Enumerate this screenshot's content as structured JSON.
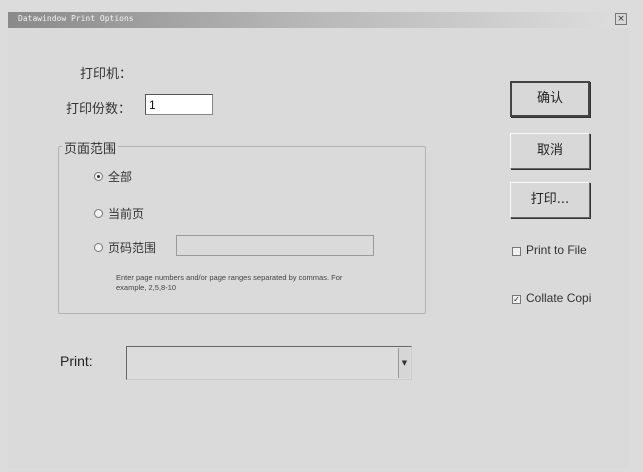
{
  "window": {
    "title": "Datawindow Print Options",
    "close_glyph": "×"
  },
  "printer": {
    "label": "打印机："
  },
  "copies": {
    "label": "打印份数：",
    "value": "1"
  },
  "page_range": {
    "group_title": "页面范围",
    "options": [
      {
        "label": "全部",
        "checked": true
      },
      {
        "label": "当前页",
        "checked": false
      },
      {
        "label": "页码范围",
        "checked": false
      }
    ],
    "range_value": "",
    "hint": "Enter page numbers and/or page ranges separated by commas. For example, 2,5,8-10"
  },
  "buttons": {
    "ok": "确认",
    "cancel": "取消",
    "print": "打印..."
  },
  "checkboxes": {
    "print_to_file": {
      "label": "Print to File",
      "checked": false
    },
    "collate": {
      "label": "Collate Copi",
      "checked": true
    }
  },
  "print_select": {
    "label": "Print:",
    "value": ""
  },
  "icons": {
    "dropdown": "dropdown-arrow-icon",
    "check": "checkmark-icon"
  }
}
